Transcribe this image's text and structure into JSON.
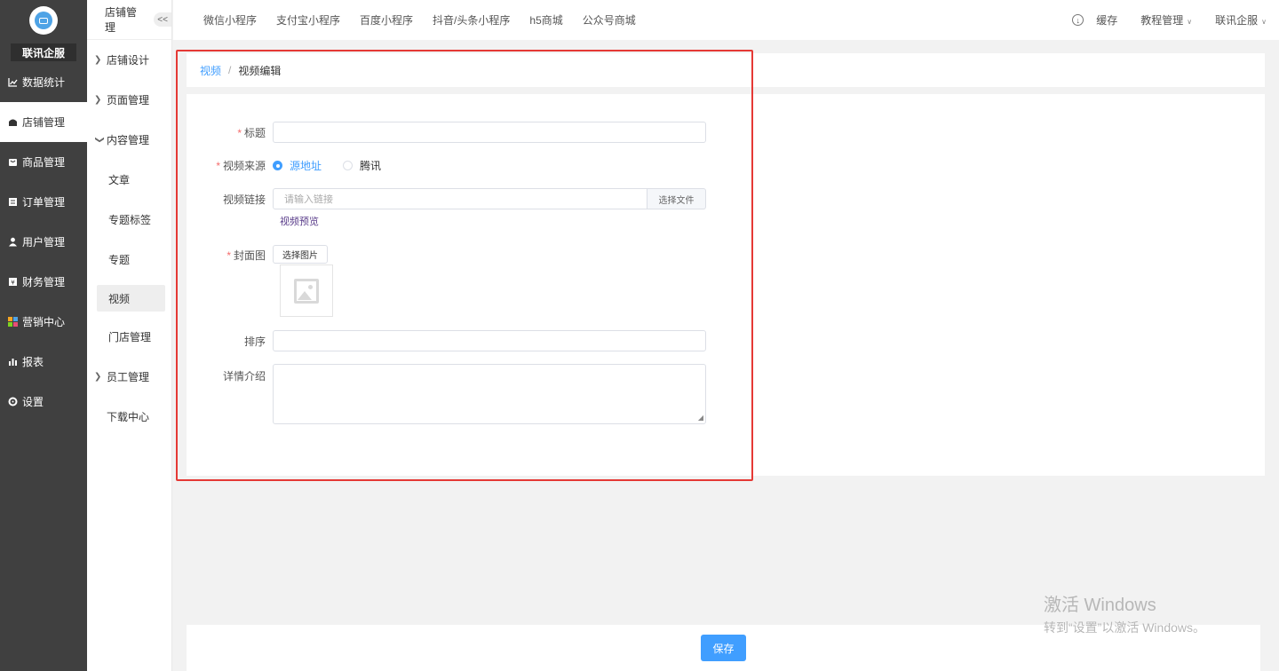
{
  "brand": "联讯企服",
  "sidebar": {
    "items": [
      {
        "label": "数据统计",
        "icon": "chart-line-icon"
      },
      {
        "label": "店铺管理",
        "icon": "shop-icon"
      },
      {
        "label": "商品管理",
        "icon": "goods-icon"
      },
      {
        "label": "订单管理",
        "icon": "order-icon"
      },
      {
        "label": "用户管理",
        "icon": "user-icon"
      },
      {
        "label": "财务管理",
        "icon": "finance-icon"
      },
      {
        "label": "营销中心",
        "icon": "marketing-icon"
      },
      {
        "label": "报表",
        "icon": "report-icon"
      },
      {
        "label": "设置",
        "icon": "settings-icon"
      }
    ],
    "active": "店铺管理"
  },
  "subbar": {
    "title": "店铺管理",
    "collapse": "<<",
    "items": {
      "store_design": "店铺设计",
      "page_manage": "页面管理",
      "content_manage": "内容管理",
      "article": "文章",
      "topic_tag": "专题标签",
      "topic": "专题",
      "video": "视频",
      "store_manage": "门店管理",
      "staff_manage": "员工管理",
      "download_center": "下载中心"
    }
  },
  "topbar": {
    "tabs": [
      "微信小程序",
      "支付宝小程序",
      "百度小程序",
      "抖音/头条小程序",
      "h5商城",
      "公众号商城"
    ],
    "cache": "缓存",
    "tutorial": "教程管理",
    "account": "联讯企服"
  },
  "breadcrumb": {
    "parent": "视频",
    "separator": "/",
    "current": "视频编辑"
  },
  "form": {
    "title_label": "标题",
    "title_value": "",
    "source_label": "视频来源",
    "source_options": [
      "源地址",
      "腾讯"
    ],
    "source_selected": "源地址",
    "link_label": "视频链接",
    "link_placeholder": "请输入链接",
    "choose_file": "选择文件",
    "preview": "视频预览",
    "cover_label": "封面图",
    "choose_image": "选择图片",
    "sort_label": "排序",
    "sort_value": "",
    "detail_label": "详情介绍",
    "detail_value": ""
  },
  "save_button": "保存",
  "watermark": {
    "line1": "激活 Windows",
    "line2": "转到“设置”以激活 Windows。"
  }
}
